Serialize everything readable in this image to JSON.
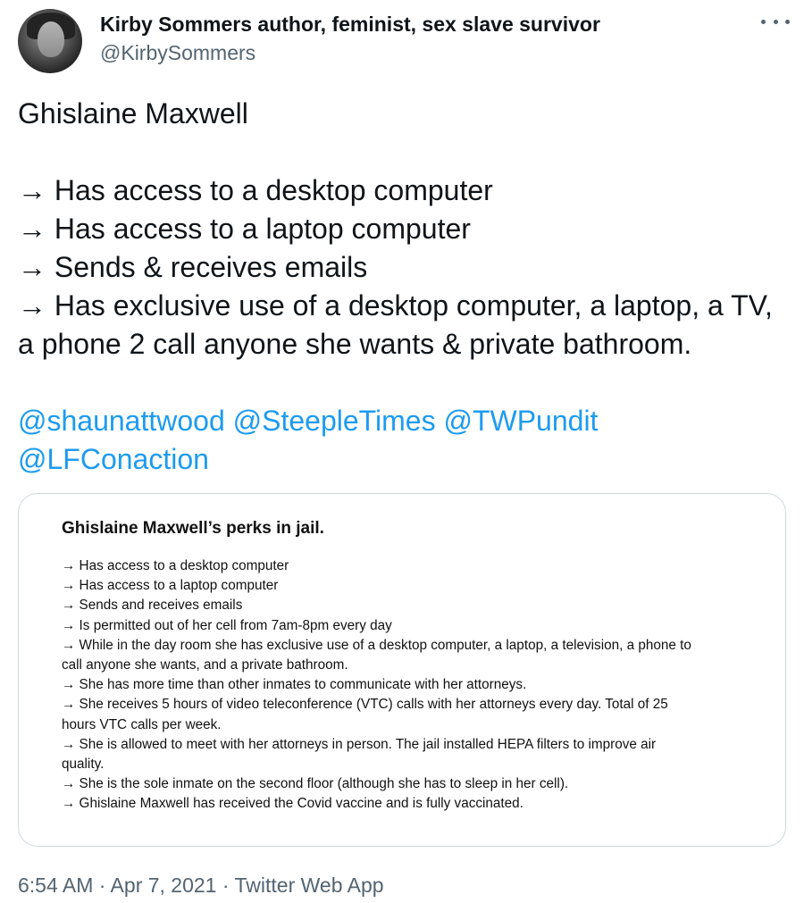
{
  "author": {
    "display_name": "Kirby Sommers author, feminist, sex slave survivor",
    "handle": "@KirbySommers"
  },
  "tweet": {
    "title_line": "Ghislaine Maxwell",
    "bullets": [
      "→ Has access to a desktop computer",
      "→ Has access to a laptop computer",
      "→ Sends & receives emails",
      "→ Has exclusive use of a desktop computer, a laptop, a TV, a phone 2 call anyone she wants & private bathroom."
    ],
    "mentions": [
      "@shaunattwood",
      "@SteepleTimes",
      "@TWPundit",
      "@LFConaction"
    ]
  },
  "image_card": {
    "title": "Ghislaine Maxwell’s perks in jail.",
    "lines": [
      "→ Has access to a desktop computer",
      "→ Has access to a laptop computer",
      "→ Sends and receives emails",
      "→ Is permitted out of her cell from 7am-8pm every day",
      "→ While in the day room she has exclusive use of a desktop computer, a laptop, a television, a phone to",
      "call anyone she wants, and a private bathroom.",
      "→ She has more time than other inmates to communicate with her attorneys.",
      "→ She receives 5 hours of video teleconference (VTC) calls with her attorneys every day. Total of 25",
      "hours VTC calls per week.",
      "→ She is allowed to meet with her attorneys in person. The jail installed HEPA filters to improve air",
      "quality.",
      "→ She is the sole inmate on the second floor (although she has to sleep in her cell).",
      "→ Ghislaine Maxwell has received the Covid vaccine and is fully vaccinated."
    ]
  },
  "meta": {
    "timestamp": "6:54 AM · Apr 7, 2021 · Twitter Web App"
  },
  "icons": {
    "more": "more-horizontal-icon"
  },
  "colors": {
    "mention": "#1d9bf0",
    "secondary_text": "#536471"
  }
}
